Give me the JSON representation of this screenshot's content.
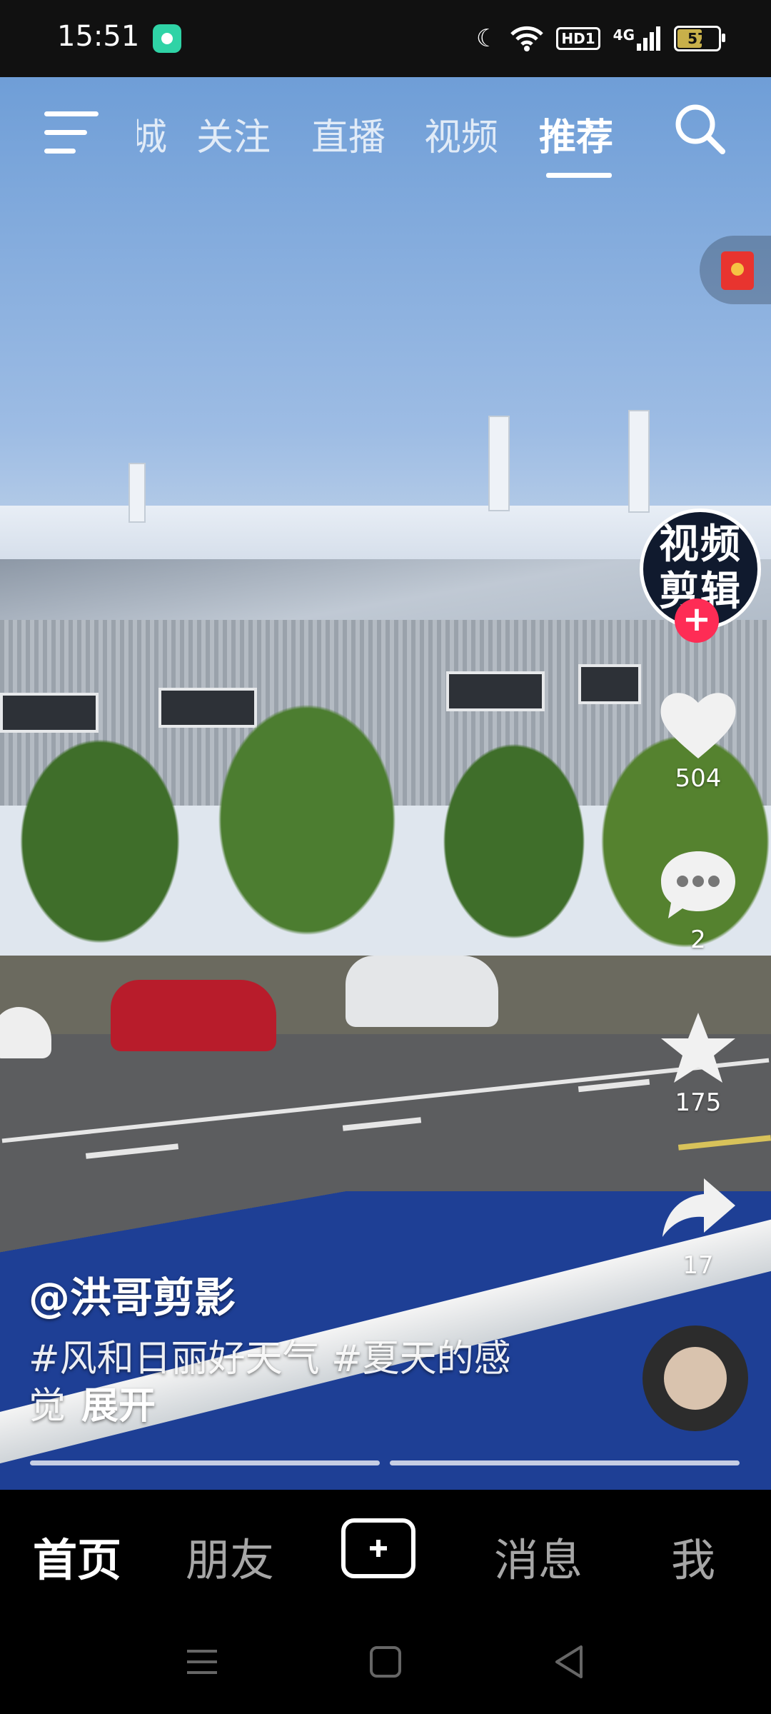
{
  "status_bar": {
    "time": "15:51",
    "network_badge": "HD1",
    "cellular": "4G",
    "battery": "57",
    "icons": [
      "app-notification-icon",
      "moon-icon",
      "wifi-icon",
      "signal-icon",
      "battery-icon"
    ]
  },
  "top_nav": {
    "tabs": [
      {
        "label": "城",
        "active": false
      },
      {
        "label": "关注",
        "active": false
      },
      {
        "label": "直播",
        "active": false
      },
      {
        "label": "视频",
        "active": false
      },
      {
        "label": "推荐",
        "active": true
      }
    ],
    "icons": [
      "menu-icon",
      "search-icon",
      "red-packet-icon"
    ]
  },
  "creator": {
    "avatar_text": "视频剪辑",
    "follow_symbol": "+"
  },
  "actions": {
    "likes": "504",
    "comments": "2",
    "favorites": "175",
    "shares": "17"
  },
  "caption": {
    "author": "@洪哥剪影",
    "text": "#风和日丽好天气 #夏天的感觉",
    "expand": "展开"
  },
  "bottom_nav": {
    "home": "首页",
    "friends": "朋友",
    "messages": "消息",
    "me": "我"
  },
  "colors": {
    "accent_red": "#fe2c55",
    "background": "#000000"
  }
}
